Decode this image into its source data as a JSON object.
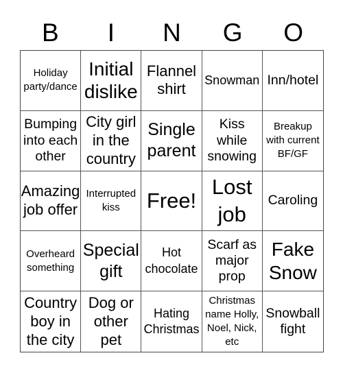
{
  "header": {
    "letters": [
      "B",
      "I",
      "N",
      "G",
      "O"
    ]
  },
  "cells": [
    "Holiday party/dance",
    "Initial dislike",
    "Flannel shirt",
    "Snowman",
    "Inn/hotel",
    "Bumping into each other",
    "City girl in the country",
    "Single parent",
    "Kiss while snowing",
    "Breakup with current BF/GF",
    "Amazing job offer",
    "Interrupted kiss",
    "Free!",
    "Lost job",
    "Caroling",
    "Overheard something",
    "Special gift",
    "Hot chocolate",
    "Scarf as major prop",
    "Fake Snow",
    "Country boy in the city",
    "Dog or other pet",
    "Hating Christmas",
    "Christmas name Holly, Noel, Nick, etc",
    "Snowball fight"
  ]
}
